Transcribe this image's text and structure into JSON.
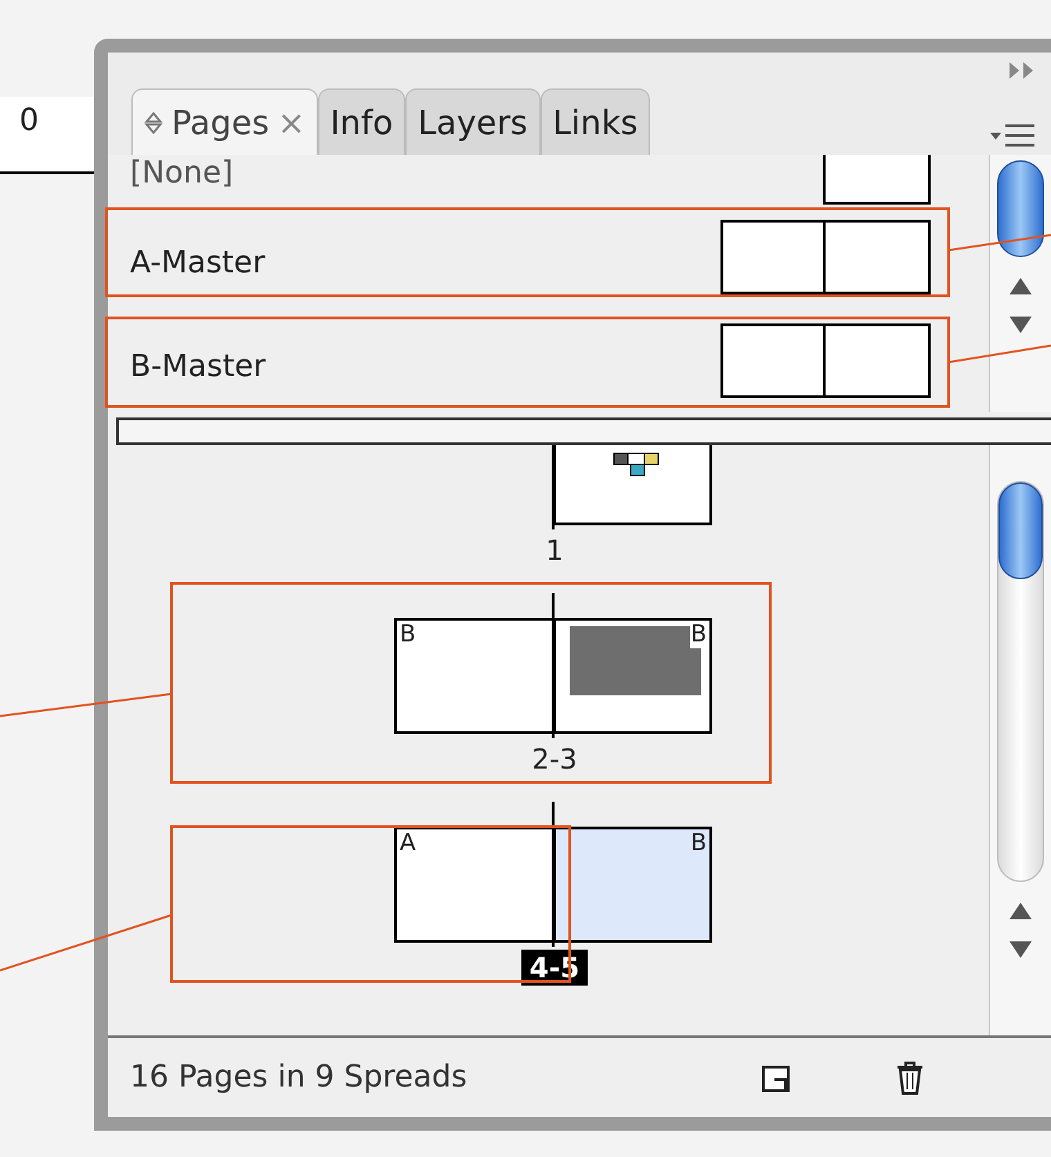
{
  "ruler": {
    "reading": "0"
  },
  "tabs": [
    {
      "label": "Pages",
      "selected": true,
      "close": "×"
    },
    {
      "label": "Info",
      "selected": false
    },
    {
      "label": "Layers",
      "selected": false
    },
    {
      "label": "Links",
      "selected": false
    }
  ],
  "masters": [
    {
      "name": "[None]",
      "kind": "single"
    },
    {
      "name": "A-Master",
      "kind": "spread"
    },
    {
      "name": "B-Master",
      "kind": "spread"
    }
  ],
  "spreads": [
    {
      "label": "1",
      "selected": false,
      "pages": [
        {
          "kind": "art",
          "selected": false
        }
      ]
    },
    {
      "label": "2-3",
      "selected": false,
      "pages": [
        {
          "master": "B",
          "kind": "blank",
          "selected": false
        },
        {
          "master": "B",
          "kind": "content",
          "selected": false
        }
      ]
    },
    {
      "label": "4-5",
      "selected": true,
      "pages": [
        {
          "master": "A",
          "kind": "blank",
          "selected": false
        },
        {
          "master": "B",
          "kind": "blank",
          "selected": true
        }
      ]
    }
  ],
  "status": "16 Pages in 9 Spreads"
}
